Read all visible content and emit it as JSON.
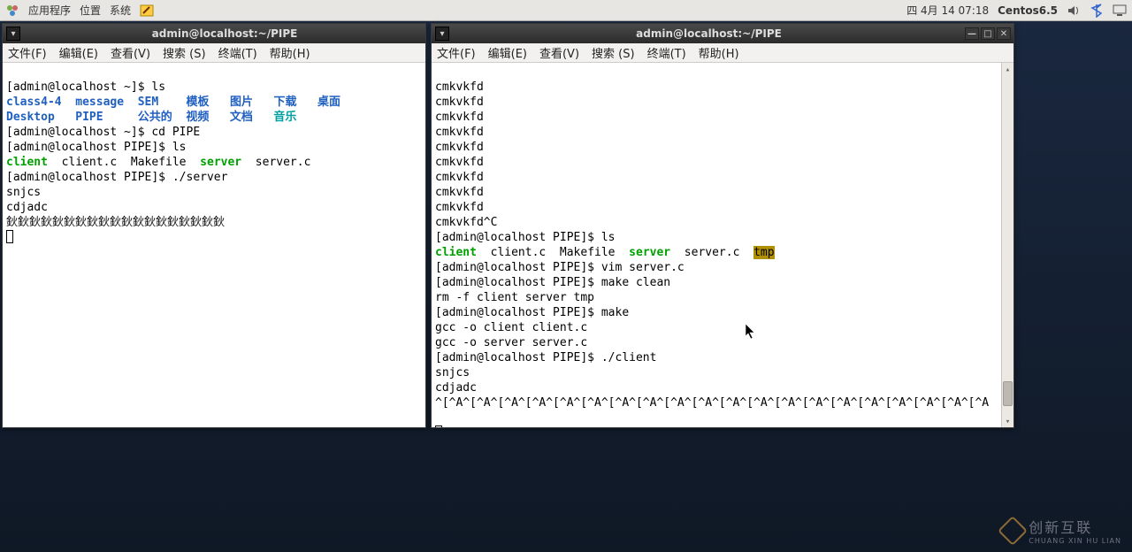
{
  "panel": {
    "apps": "应用程序",
    "places": "位置",
    "system": "系统",
    "date": "四 4月 14 07:18",
    "host": "Centos6.5"
  },
  "win1": {
    "title": "admin@localhost:~/PIPE",
    "menu": {
      "file": "文件(F)",
      "edit": "编辑(E)",
      "view": "查看(V)",
      "search": "搜索 (S)",
      "terminal": "终端(T)",
      "help": "帮助(H)"
    },
    "lines": {
      "l1_prompt": "[admin@localhost ~]$ ",
      "l1_cmd": "ls",
      "l2a": "class4-4",
      "l2b": "message",
      "l2c": "SEM",
      "l2d": "模板",
      "l2e": "图片",
      "l2f": "下载",
      "l2g": "桌面",
      "l3a": "Desktop",
      "l3b": "PIPE",
      "l3c": "公共的",
      "l3d": "视频",
      "l3e": "文档",
      "l3f": "音乐",
      "l4": "[admin@localhost ~]$ cd PIPE",
      "l5": "[admin@localhost PIPE]$ ls",
      "l6a": "client",
      "l6b": "client.c  Makefile",
      "l6c": "server",
      "l6d": "server.c",
      "l7": "[admin@localhost PIPE]$ ./server",
      "l8": "snjcs",
      "l9": "cdjadc",
      "l10": "鈥鈥鈥鈥鈥鈥鈥鈥鈥鈥鈥鈥鈥鈥鈥鈥鈥鈥鈥"
    }
  },
  "win2": {
    "title": "admin@localhost:~/PIPE",
    "menu": {
      "file": "文件(F)",
      "edit": "编辑(E)",
      "view": "查看(V)",
      "search": "搜索 (S)",
      "terminal": "终端(T)",
      "help": "帮助(H)"
    },
    "lines": {
      "rep": "cmkvkfd",
      "repc": "cmkvkfd^C",
      "p_ls": "[admin@localhost PIPE]$ ls",
      "ls_a": "client",
      "ls_b": "client.c  Makefile",
      "ls_c": "server",
      "ls_d": "server.c",
      "ls_e": "tmp",
      "p_vim": "[admin@localhost PIPE]$ vim server.c",
      "p_mc": "[admin@localhost PIPE]$ make clean",
      "rm": "rm -f client server tmp",
      "p_mk": "[admin@localhost PIPE]$ make",
      "g1": "gcc -o client client.c",
      "g2": "gcc -o server server.c",
      "p_cl": "[admin@localhost PIPE]$ ./client",
      "o1": "snjcs",
      "o2": "cdjadc",
      "o3": "^[^A^[^A^[^A^[^A^[^A^[^A^[^A^[^A^[^A^[^A^[^A^[^A^[^A^[^A^[^A^[^A^[^A^[^A^[^A^[^A"
    }
  },
  "watermark": {
    "line1": "创新互联",
    "line2": "CHUANG XIN HU LIAN"
  }
}
